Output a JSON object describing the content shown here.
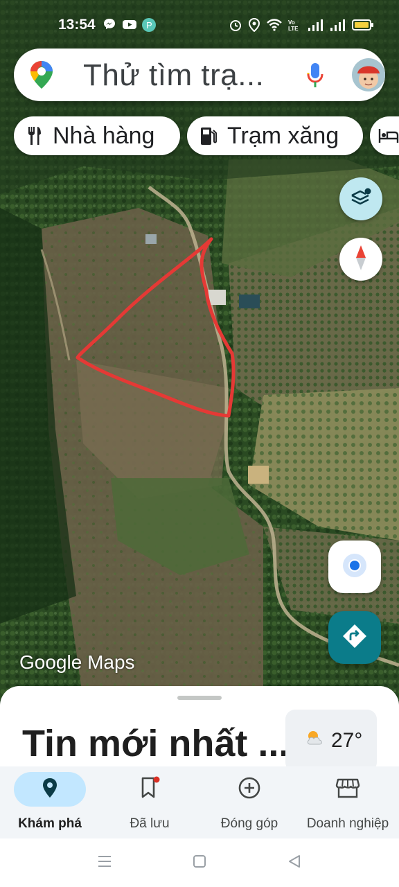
{
  "status_bar": {
    "time": "13:54",
    "notification_icons": [
      "messenger-icon",
      "youtube-icon",
      "app-icon"
    ],
    "system_icons": [
      "alarm-icon",
      "location-icon",
      "wifi-icon",
      "volte-icon",
      "signal-icon",
      "signal-icon",
      "battery-icon"
    ]
  },
  "search": {
    "placeholder": "Thử tìm trạ..."
  },
  "chips": [
    {
      "label": "Nhà hàng",
      "icon": "restaurant-icon"
    },
    {
      "label": "Trạm xăng",
      "icon": "gas-station-icon"
    },
    {
      "label": "",
      "icon": "hotel-icon"
    }
  ],
  "map": {
    "watermark_brand": "Google",
    "watermark_product": "Maps",
    "annotation_color": "#e53935"
  },
  "sheet": {
    "title": "Tin mới nhất ...",
    "weather_temp": "27°",
    "weather_icon": "partly-cloudy-icon"
  },
  "bottom_nav": {
    "items": [
      {
        "label": "Khám phá",
        "icon": "explore-pin-icon",
        "active": true
      },
      {
        "label": "Đã lưu",
        "icon": "bookmark-icon",
        "active": false
      },
      {
        "label": "Đóng góp",
        "icon": "add-circle-icon",
        "active": false
      },
      {
        "label": "Doanh nghiệp",
        "icon": "storefront-icon",
        "active": false
      }
    ]
  },
  "colors": {
    "accent_blue": "#1a73e8",
    "active_pill": "#c2e7ff",
    "directions_button": "#0b7c8a"
  }
}
